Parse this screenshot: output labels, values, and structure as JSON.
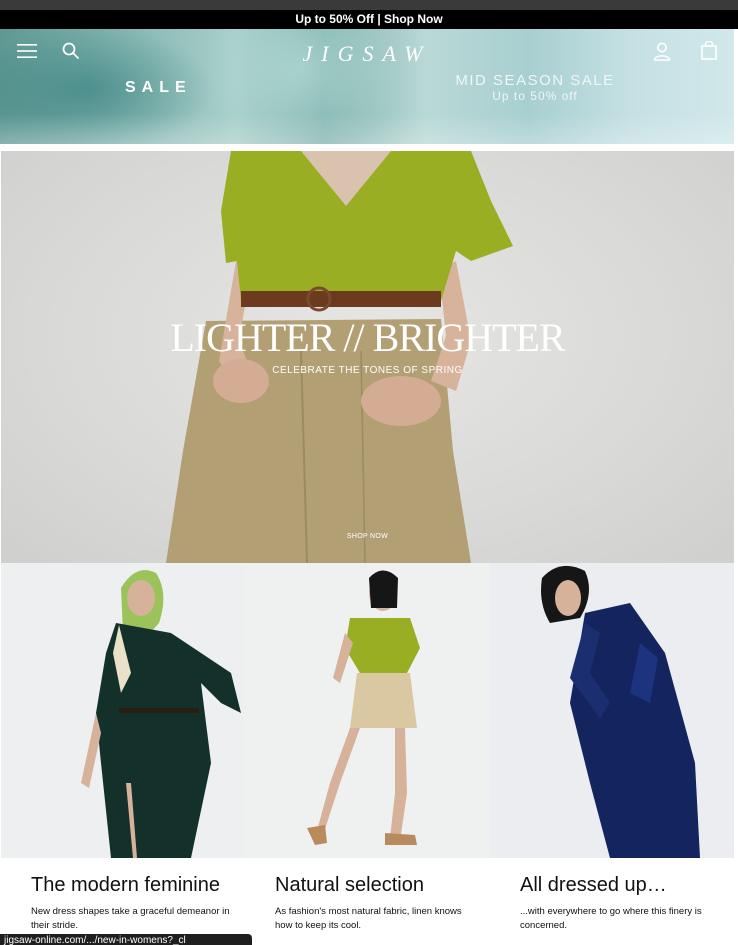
{
  "announcement": "Up to 50% Off | Shop Now",
  "header": {
    "logo": "JIGSAW",
    "icons": [
      "menu-icon",
      "search-icon",
      "account-icon",
      "bag-icon"
    ]
  },
  "banner": {
    "sale_label": "SALE",
    "mid_title": "MID SEASON SALE",
    "mid_subtitle": "Up to 50% off"
  },
  "feature": {
    "title": "LIGHTER // BRIGHTER",
    "subtitle": "CELEBRATE THE TONES OF SPRING",
    "cta": "SHOP NOW"
  },
  "cards": [
    {
      "title": "The modern feminine",
      "description": "New dress shapes take a graceful demeanor in their stride."
    },
    {
      "title": "Natural selection",
      "description": "As fashion's most natural fabric, linen knows how to keep its cool."
    },
    {
      "title": "All dressed up…",
      "description": "...with everywhere to go where this finery is concerned."
    }
  ],
  "status_bar_url": "jigsaw-online.com/.../new-in-womens?_cl",
  "colors": {
    "announcement_bg": "#000000",
    "banner_teal": "#88b8b3",
    "sweater_green": "#9aae24",
    "shorts_khaki": "#b29f74",
    "dress_dark_green": "#14302a",
    "dress_navy": "#14245e"
  }
}
